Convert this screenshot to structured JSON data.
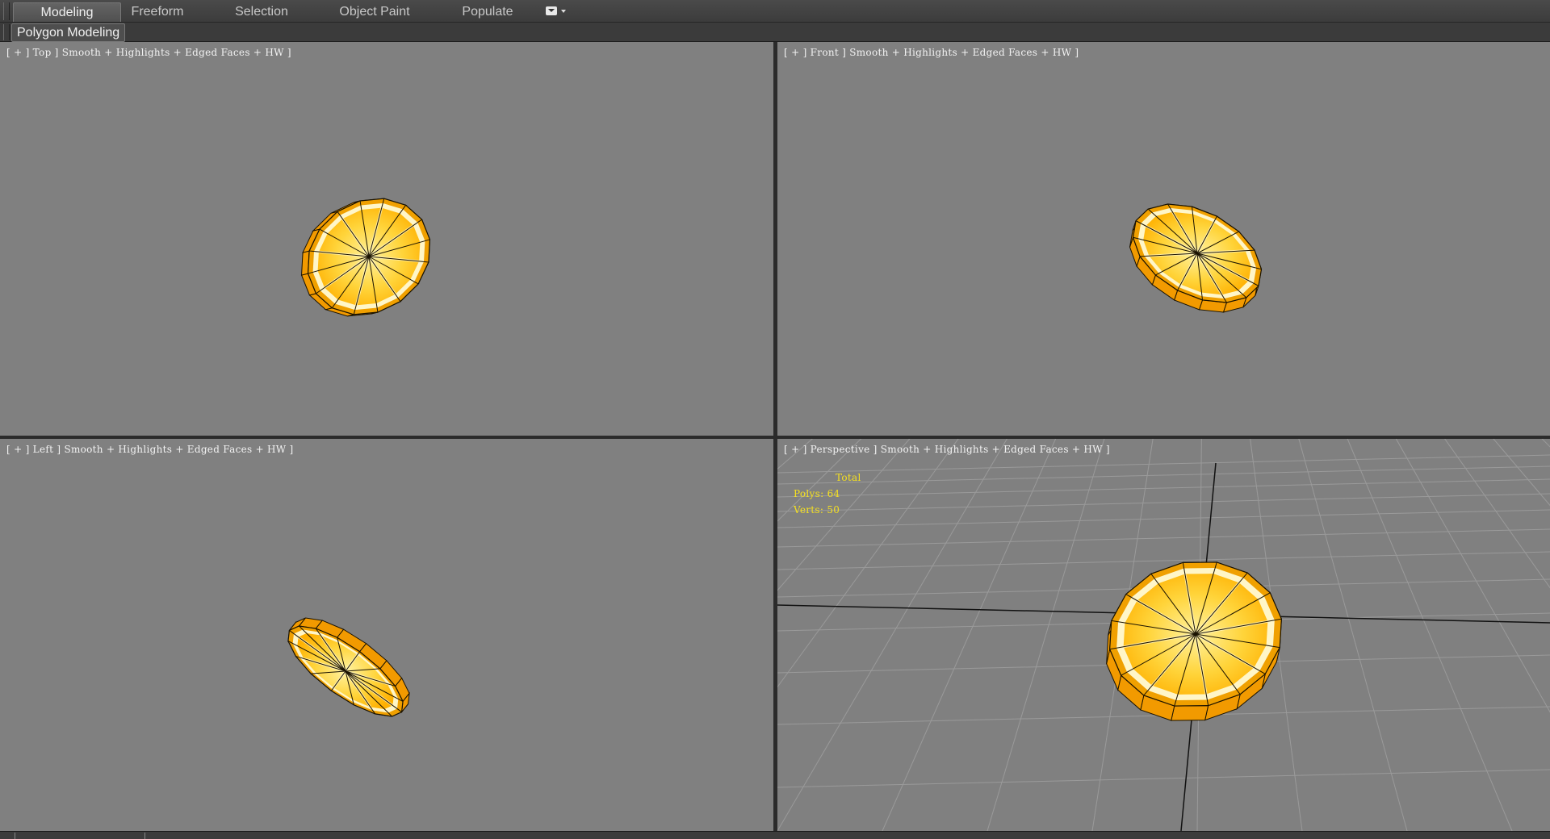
{
  "ribbon": {
    "tabs": [
      {
        "label": "Modeling",
        "active": true
      },
      {
        "label": "Freeform",
        "active": false
      },
      {
        "label": "Selection",
        "active": false
      },
      {
        "label": "Object Paint",
        "active": false
      },
      {
        "label": "Populate",
        "active": false
      }
    ],
    "toggle_icon": "ribbon-minimize-icon",
    "panel_label": "Polygon Modeling"
  },
  "viewports": [
    {
      "id": "top",
      "view": "Top",
      "mode": "Smooth + Highlights + Edged Faces + HW"
    },
    {
      "id": "front",
      "view": "Front",
      "mode": "Smooth + Highlights + Edged Faces + HW"
    },
    {
      "id": "left",
      "view": "Left",
      "mode": "Smooth + Highlights + Edged Faces + HW"
    },
    {
      "id": "perspective",
      "view": "Perspective",
      "mode": "Smooth + Highlights + Edged Faces + HW"
    }
  ],
  "stats": {
    "title": "Total",
    "polys_label": "Polys:",
    "polys_value": "64",
    "verts_label": "Verts:",
    "verts_value": "50"
  },
  "colors": {
    "viewport_bg": "#808080",
    "rind": "#f0a000",
    "flesh": "#ffd43a",
    "pith": "#fff6c8",
    "stats_text": "#f5e020"
  }
}
